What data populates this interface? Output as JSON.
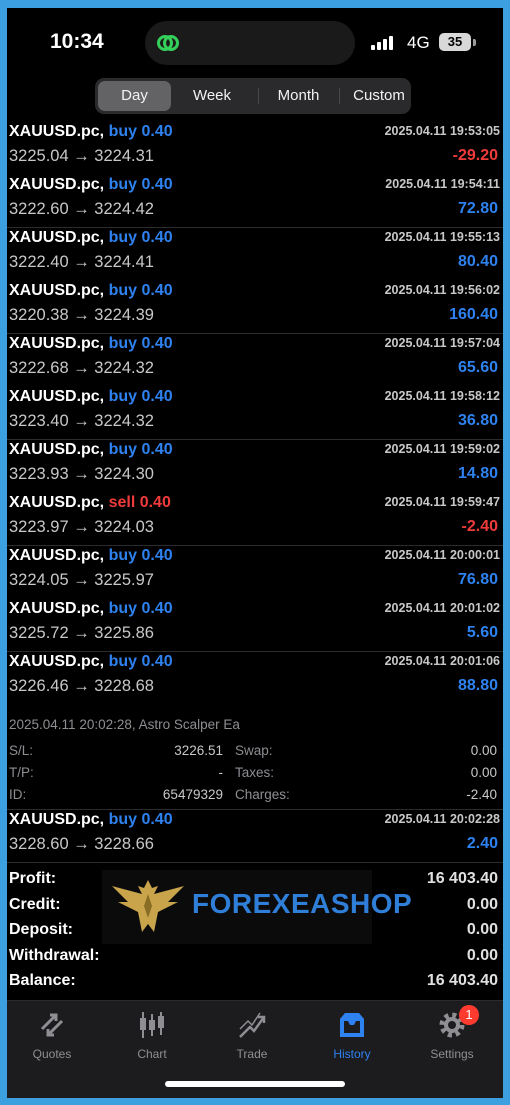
{
  "status": {
    "time": "10:34",
    "network": "4G",
    "battery": "35"
  },
  "period_tabs": [
    {
      "label": "Day",
      "active": true
    },
    {
      "label": "Week",
      "active": false
    },
    {
      "label": "Month",
      "active": false
    },
    {
      "label": "Custom",
      "active": false
    }
  ],
  "trades": [
    {
      "symbol": "XAUUSD.pc,",
      "side": "buy 0.40",
      "datetime": "2025.04.11 19:53:05",
      "prices": "3225.04 → 3224.31",
      "profit": "-29.20",
      "negative": true
    },
    {
      "symbol": "XAUUSD.pc,",
      "side": "buy 0.40",
      "datetime": "2025.04.11 19:54:11",
      "prices": "3222.60 → 3224.42",
      "profit": "72.80",
      "negative": false
    },
    {
      "symbol": "XAUUSD.pc,",
      "side": "buy 0.40",
      "datetime": "2025.04.11 19:55:13",
      "prices": "3222.40 → 3224.41",
      "profit": "80.40",
      "negative": false
    },
    {
      "symbol": "XAUUSD.pc,",
      "side": "buy 0.40",
      "datetime": "2025.04.11 19:56:02",
      "prices": "3220.38 → 3224.39",
      "profit": "160.40",
      "negative": false
    },
    {
      "symbol": "XAUUSD.pc,",
      "side": "buy 0.40",
      "datetime": "2025.04.11 19:57:04",
      "prices": "3222.68 → 3224.32",
      "profit": "65.60",
      "negative": false
    },
    {
      "symbol": "XAUUSD.pc,",
      "side": "buy 0.40",
      "datetime": "2025.04.11 19:58:12",
      "prices": "3223.40 → 3224.32",
      "profit": "36.80",
      "negative": false
    },
    {
      "symbol": "XAUUSD.pc,",
      "side": "buy 0.40",
      "datetime": "2025.04.11 19:59:02",
      "prices": "3223.93 → 3224.30",
      "profit": "14.80",
      "negative": false
    },
    {
      "symbol": "XAUUSD.pc,",
      "side": "sell 0.40",
      "datetime": "2025.04.11 19:59:47",
      "prices": "3223.97 → 3224.03",
      "profit": "-2.40",
      "negative": true
    },
    {
      "symbol": "XAUUSD.pc,",
      "side": "buy 0.40",
      "datetime": "2025.04.11 20:00:01",
      "prices": "3224.05 → 3225.97",
      "profit": "76.80",
      "negative": false
    },
    {
      "symbol": "XAUUSD.pc,",
      "side": "buy 0.40",
      "datetime": "2025.04.11 20:01:02",
      "prices": "3225.72 → 3225.86",
      "profit": "5.60",
      "negative": false
    },
    {
      "symbol": "XAUUSD.pc,",
      "side": "buy 0.40",
      "datetime": "2025.04.11 20:01:06",
      "prices": "3226.46 → 3228.68",
      "profit": "88.80",
      "negative": false
    }
  ],
  "details": {
    "line": "2025.04.11 20:02:28, Astro Scalper Ea",
    "sl_label": "S/L:",
    "sl_value": "3226.51",
    "swap_label": "Swap:",
    "swap_value": "0.00",
    "tp_label": "T/P:",
    "tp_value": "-",
    "taxes_label": "Taxes:",
    "taxes_value": "0.00",
    "id_label": "ID:",
    "id_value": "65479329",
    "charges_label": "Charges:",
    "charges_value": "-2.40"
  },
  "last_trade": {
    "symbol": "XAUUSD.pc,",
    "side": "buy 0.40",
    "datetime": "2025.04.11 20:02:28",
    "prices": "3228.60 → 3228.66",
    "profit": "2.40",
    "negative": false
  },
  "summary": [
    {
      "label": "Profit:",
      "value": "16 403.40"
    },
    {
      "label": "Credit:",
      "value": "0.00"
    },
    {
      "label": "Deposit:",
      "value": "0.00"
    },
    {
      "label": "Withdrawal:",
      "value": "0.00"
    },
    {
      "label": "Balance:",
      "value": "16 403.40"
    }
  ],
  "watermark": {
    "text": "FOREXEASHOP"
  },
  "tabs": [
    {
      "label": "Quotes",
      "icon": "quotes-icon",
      "active": false
    },
    {
      "label": "Chart",
      "icon": "chart-icon",
      "active": false
    },
    {
      "label": "Trade",
      "icon": "trade-icon",
      "active": false
    },
    {
      "label": "History",
      "icon": "history-icon",
      "active": true
    },
    {
      "label": "Settings",
      "icon": "settings-icon",
      "active": false,
      "badge": "1"
    }
  ],
  "colors": {
    "buy": "#2e82f0",
    "sell": "#f03b3b",
    "active_tab": "#2e82f0",
    "background": "#000000"
  }
}
